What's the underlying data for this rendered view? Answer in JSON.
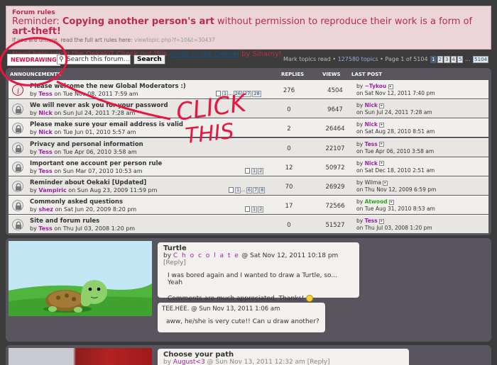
{
  "rules": {
    "title": "Forum rules",
    "reminder_pre": "Reminder: ",
    "reminder_b1": "Copying another person's art",
    "reminder_mid": " without permission to reproduce their work is a form of ",
    "reminder_b2": "art-theft!",
    "unsure_text": "If you are unsure, read the full art rules here: ",
    "unsure_link": "viewtopic.php?f=10&t=30437",
    "help_pre": "Need help using the Oekaki? Check out this ",
    "help_link": "guide to the Oekaki",
    "help_post": " by Sinamy!"
  },
  "actionbar": {
    "new_drawing": "NEWDRAWING",
    "search_placeholder": "Search this forum...",
    "search_button": "Search",
    "mark_read": "Mark topics read",
    "topics": "127580 topics",
    "page_of": "Page 1 of 5104",
    "pages": [
      "1",
      "2",
      "3",
      "4",
      "5"
    ],
    "ellipsis": "...",
    "last_page": "5104"
  },
  "table": {
    "col_announcements": "ANNOUNCEMENTS",
    "col_replies": "REPLIES",
    "col_views": "VIEWS",
    "col_last": "LAST POST",
    "rows": [
      {
        "title": "Please welcome the new Global Moderators :)",
        "by": "by",
        "author": "Tess",
        "date": "on Tue Nov 08, 2011 7:59 am",
        "pages": [
          "1",
          "...",
          "26",
          "27",
          "28"
        ],
        "replies": "276",
        "views": "4504",
        "last_by": "by",
        "last_author": "~Tykou",
        "last_date": "on Sat Nov 12, 2011 7:40 pm"
      },
      {
        "title": "We will never ask you for your password",
        "by": "by",
        "author": "Nick",
        "date": "on Sun Jul 24, 2011 7:28 am",
        "replies": "0",
        "views": "9647",
        "last_by": "by",
        "last_author": "Nick",
        "last_date": "on Sun Jul 24, 2011 7:28 am"
      },
      {
        "title": "Please make sure your email address is valid",
        "by": "by",
        "author": "Nick",
        "date": "on Tue Jun 01, 2010 5:57 am",
        "replies": "2",
        "views": "26464",
        "last_by": "by",
        "last_author": "Nick",
        "last_date": "on Sat Aug 28, 2010 8:51 am"
      },
      {
        "title": "Privacy and personal information",
        "by": "by",
        "author": "Tess",
        "date": "on Tue Apr 06, 2010 3:58 am",
        "replies": "0",
        "views": "22107",
        "last_by": "by",
        "last_author": "Tess",
        "last_date": "on Tue Apr 06, 2010 3:58 am"
      },
      {
        "title": "Important one account per person rule",
        "by": "by",
        "author": "Tess",
        "date": "on Sun Mar 07, 2010 10:53 am",
        "pages": [
          "1",
          "2"
        ],
        "replies": "12",
        "views": "50972",
        "last_by": "by",
        "last_author": "Nick",
        "last_date": "on Sat Dec 18, 2010 2:51 am"
      },
      {
        "title": "Reminder about Oekaki [Updated]",
        "by": "by",
        "author": "Vampiric",
        "date": "on Sun Aug 23, 2009 11:59 pm",
        "pages": [
          "1",
          "...",
          "6",
          "7",
          "8"
        ],
        "replies": "70",
        "views": "26929",
        "last_by": "by",
        "last_author": "Wilma",
        "last_date": "on Thu Nov 12, 2009 6:59 pm"
      },
      {
        "title": "Commonly asked questions",
        "by": "by",
        "author": "shez",
        "date": "on Sat Jun 20, 2009 8:20 pm",
        "pages": [
          "1",
          "2"
        ],
        "replies": "17",
        "views": "72566",
        "last_by": "by",
        "last_author": "Atwood",
        "last_date": "on Tue Aug 31, 2010 8:53 am"
      },
      {
        "title": "Site and forum rules",
        "by": "by",
        "author": "Tess",
        "date": "on Thu Jul 03, 2008 1:20 pm",
        "replies": "0",
        "views": "51527",
        "last_by": "by",
        "last_author": "Tess",
        "last_date": "on Thu Jul 03, 2008 1:20 pm"
      }
    ]
  },
  "post1": {
    "title": "Turtle",
    "by": "by ",
    "author": "C h o c o l a t e",
    "date": " @ Sat Nov 12, 2011 10:18 pm ",
    "reply": "[Reply]",
    "text1": "I was bored again and I wanted to draw a Turtle, so... Yeah",
    "text2": "Comments are much appreciated, Thanks!",
    "comment_head": "TEE.HEE. @ Sun Nov 13, 2011 1:06 am",
    "comment_text": "aww, he/she is very cute!! Can u draw another?"
  },
  "post2": {
    "title": "Choose your path",
    "by": "by ",
    "author": "August<3",
    "date": " @ Sun Nov 13, 2011 12:32 am ",
    "reply": "[Reply]"
  },
  "annotation": {
    "text_line1": "CLICK",
    "text_line2": "THIS",
    "color": "#e8173f"
  },
  "colors": {
    "page_bg": "#3c3c3c",
    "panel_bg": "#59555e",
    "rules_bg": "#ecd5d8",
    "accent": "#bc2a4d",
    "author": "#9e1fa8"
  }
}
